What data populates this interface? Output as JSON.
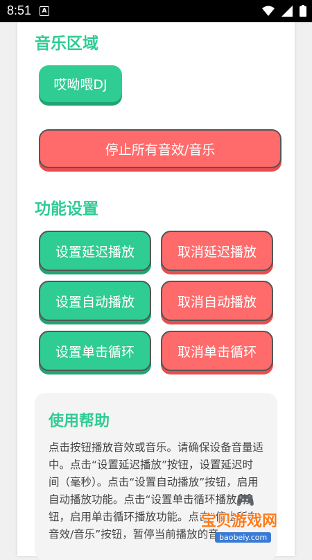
{
  "statusbar": {
    "time": "8:51",
    "notif_letter": "A"
  },
  "music_section": {
    "title": "音乐区域",
    "track_button": "哎呦喂DJ",
    "stop_button": "停止所有音效/音乐"
  },
  "settings_section": {
    "title": "功能设置",
    "set_delay": "设置延迟播放",
    "cancel_delay": "取消延迟播放",
    "set_auto": "设置自动播放",
    "cancel_auto": "取消自动播放",
    "set_loop": "设置单击循环",
    "cancel_loop": "取消单击循环"
  },
  "help_section": {
    "title": "使用帮助",
    "text": "点击按钮播放音效或音乐。请确保设备音量适中。点击“设置延迟播放”按钮，设置延迟时间（毫秒）。点击“设置自动播放”按钮，启用自动播放功能。点击“设置单击循环播放”按钮，启用单击循环播放功能。点击“停止所有音效/音乐”按钮，暂停当前播放的音"
  },
  "watermark": {
    "text": "宝贝游戏网",
    "url": "baobeiy.com"
  },
  "colors": {
    "accent_green": "#2fcc94",
    "accent_red": "#ff6b6b"
  }
}
